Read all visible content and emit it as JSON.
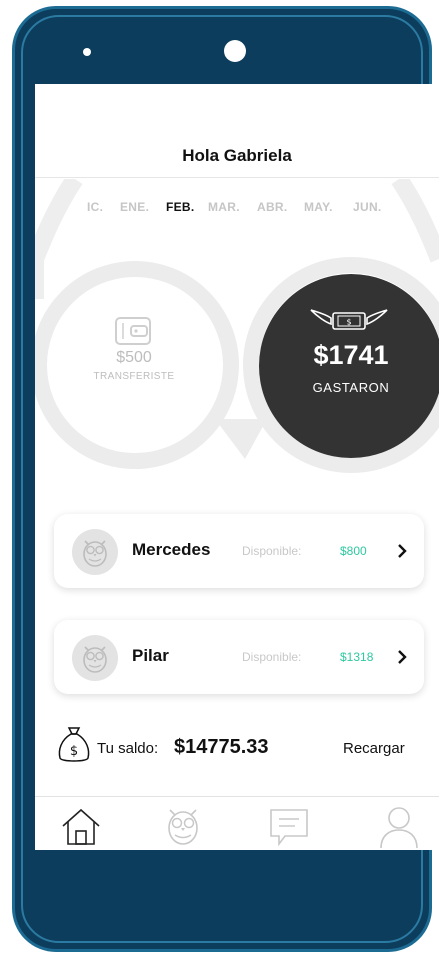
{
  "greeting": "Hola Gabriela",
  "months": [
    "IC.",
    "ENE.",
    "FEB.",
    "MAR.",
    "ABR.",
    "MAY.",
    "JUN."
  ],
  "active_month": "FEB.",
  "transfer": {
    "amount": "$500",
    "label": "TRANSFERISTE",
    "icon": "wallet-icon"
  },
  "spent": {
    "amount": "$1741",
    "label": "GASTARON",
    "icon": "flying-money-icon"
  },
  "kids": [
    {
      "name": "Mercedes",
      "available_label": "Disponible:",
      "available_value": "$800",
      "avatar": "owl-avatar-icon"
    },
    {
      "name": "Pilar",
      "available_label": "Disponible:",
      "available_value": "$1318",
      "avatar": "owl-avatar-icon"
    }
  ],
  "balance": {
    "label": "Tu saldo:",
    "value": "$14775.33",
    "action": "Recargar",
    "icon": "money-bag-icon"
  },
  "nav": [
    {
      "icon": "home-icon"
    },
    {
      "icon": "owl-icon"
    },
    {
      "icon": "chat-icon"
    },
    {
      "icon": "profile-icon"
    }
  ],
  "colors": {
    "device": "#0d3d5c",
    "accent_green": "#2ec9a0",
    "dark_circle": "#333333",
    "muted_text": "#bdbdbd"
  }
}
